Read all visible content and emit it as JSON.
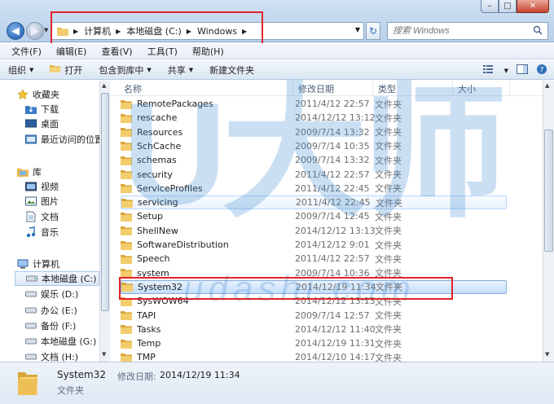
{
  "address": {
    "crumbs": [
      "计算机",
      "本地磁盘 (C:)",
      "Windows"
    ],
    "search_placeholder": "搜索 Windows"
  },
  "menu": [
    "文件(F)",
    "编辑(E)",
    "查看(V)",
    "工具(T)",
    "帮助(H)"
  ],
  "toolbar": {
    "organize": "组织",
    "open": "打开",
    "include_library": "包含到库中",
    "share": "共享",
    "new_folder": "新建文件夹"
  },
  "nav": {
    "favorites": "收藏夹",
    "downloads": "下载",
    "desktop": "桌面",
    "recent": "最近访问的位置",
    "libraries": "库",
    "videos": "视频",
    "pictures": "图片",
    "documents": "文档",
    "music": "音乐",
    "computer": "计算机",
    "drives": [
      "本地磁盘 (C:)",
      "娱乐 (D:)",
      "办公 (E:)",
      "备份 (F:)",
      "本地磁盘 (G:)",
      "文档 (H:)"
    ]
  },
  "columns": {
    "name": "名称",
    "date": "修改日期",
    "type": "类型",
    "size": "大小"
  },
  "files": [
    {
      "name": "RemotePackages",
      "date": "2011/4/12 22:57",
      "type": "文件夹"
    },
    {
      "name": "rescache",
      "date": "2014/12/12 13:12",
      "type": "文件夹"
    },
    {
      "name": "Resources",
      "date": "2009/7/14 13:32",
      "type": "文件夹"
    },
    {
      "name": "SchCache",
      "date": "2009/7/14 10:35",
      "type": "文件夹"
    },
    {
      "name": "schemas",
      "date": "2009/7/14 13:32",
      "type": "文件夹"
    },
    {
      "name": "security",
      "date": "2011/4/12 22:57",
      "type": "文件夹"
    },
    {
      "name": "ServiceProfiles",
      "date": "2011/4/12 22:45",
      "type": "文件夹"
    },
    {
      "name": "servicing",
      "date": "2011/4/12 22:45",
      "type": "文件夹"
    },
    {
      "name": "Setup",
      "date": "2009/7/14 12:45",
      "type": "文件夹"
    },
    {
      "name": "ShellNew",
      "date": "2014/12/12 13:13",
      "type": "文件夹"
    },
    {
      "name": "SoftwareDistribution",
      "date": "2014/12/12 9:01",
      "type": "文件夹"
    },
    {
      "name": "Speech",
      "date": "2011/4/12 22:57",
      "type": "文件夹"
    },
    {
      "name": "system",
      "date": "2009/7/14 10:36",
      "type": "文件夹"
    },
    {
      "name": "System32",
      "date": "2014/12/19 11:34",
      "type": "文件夹"
    },
    {
      "name": "SysWOW64",
      "date": "2014/12/12 13:13",
      "type": "文件夹"
    },
    {
      "name": "TAPI",
      "date": "2009/7/14 12:57",
      "type": "文件夹"
    },
    {
      "name": "Tasks",
      "date": "2014/12/12 11:40",
      "type": "文件夹"
    },
    {
      "name": "Temp",
      "date": "2014/12/19 11:31",
      "type": "文件夹"
    },
    {
      "name": "TMP",
      "date": "2014/12/10 14:17",
      "type": "文件夹"
    }
  ],
  "details": {
    "name": "System32",
    "date_label": "修改日期:",
    "date": "2014/12/19 11:34",
    "type": "文件夹"
  },
  "watermark": {
    "logo": "U大师",
    "url": "udashi.com"
  },
  "colors": {
    "highlight": "#e0242a",
    "folder": "#e8b84a"
  }
}
